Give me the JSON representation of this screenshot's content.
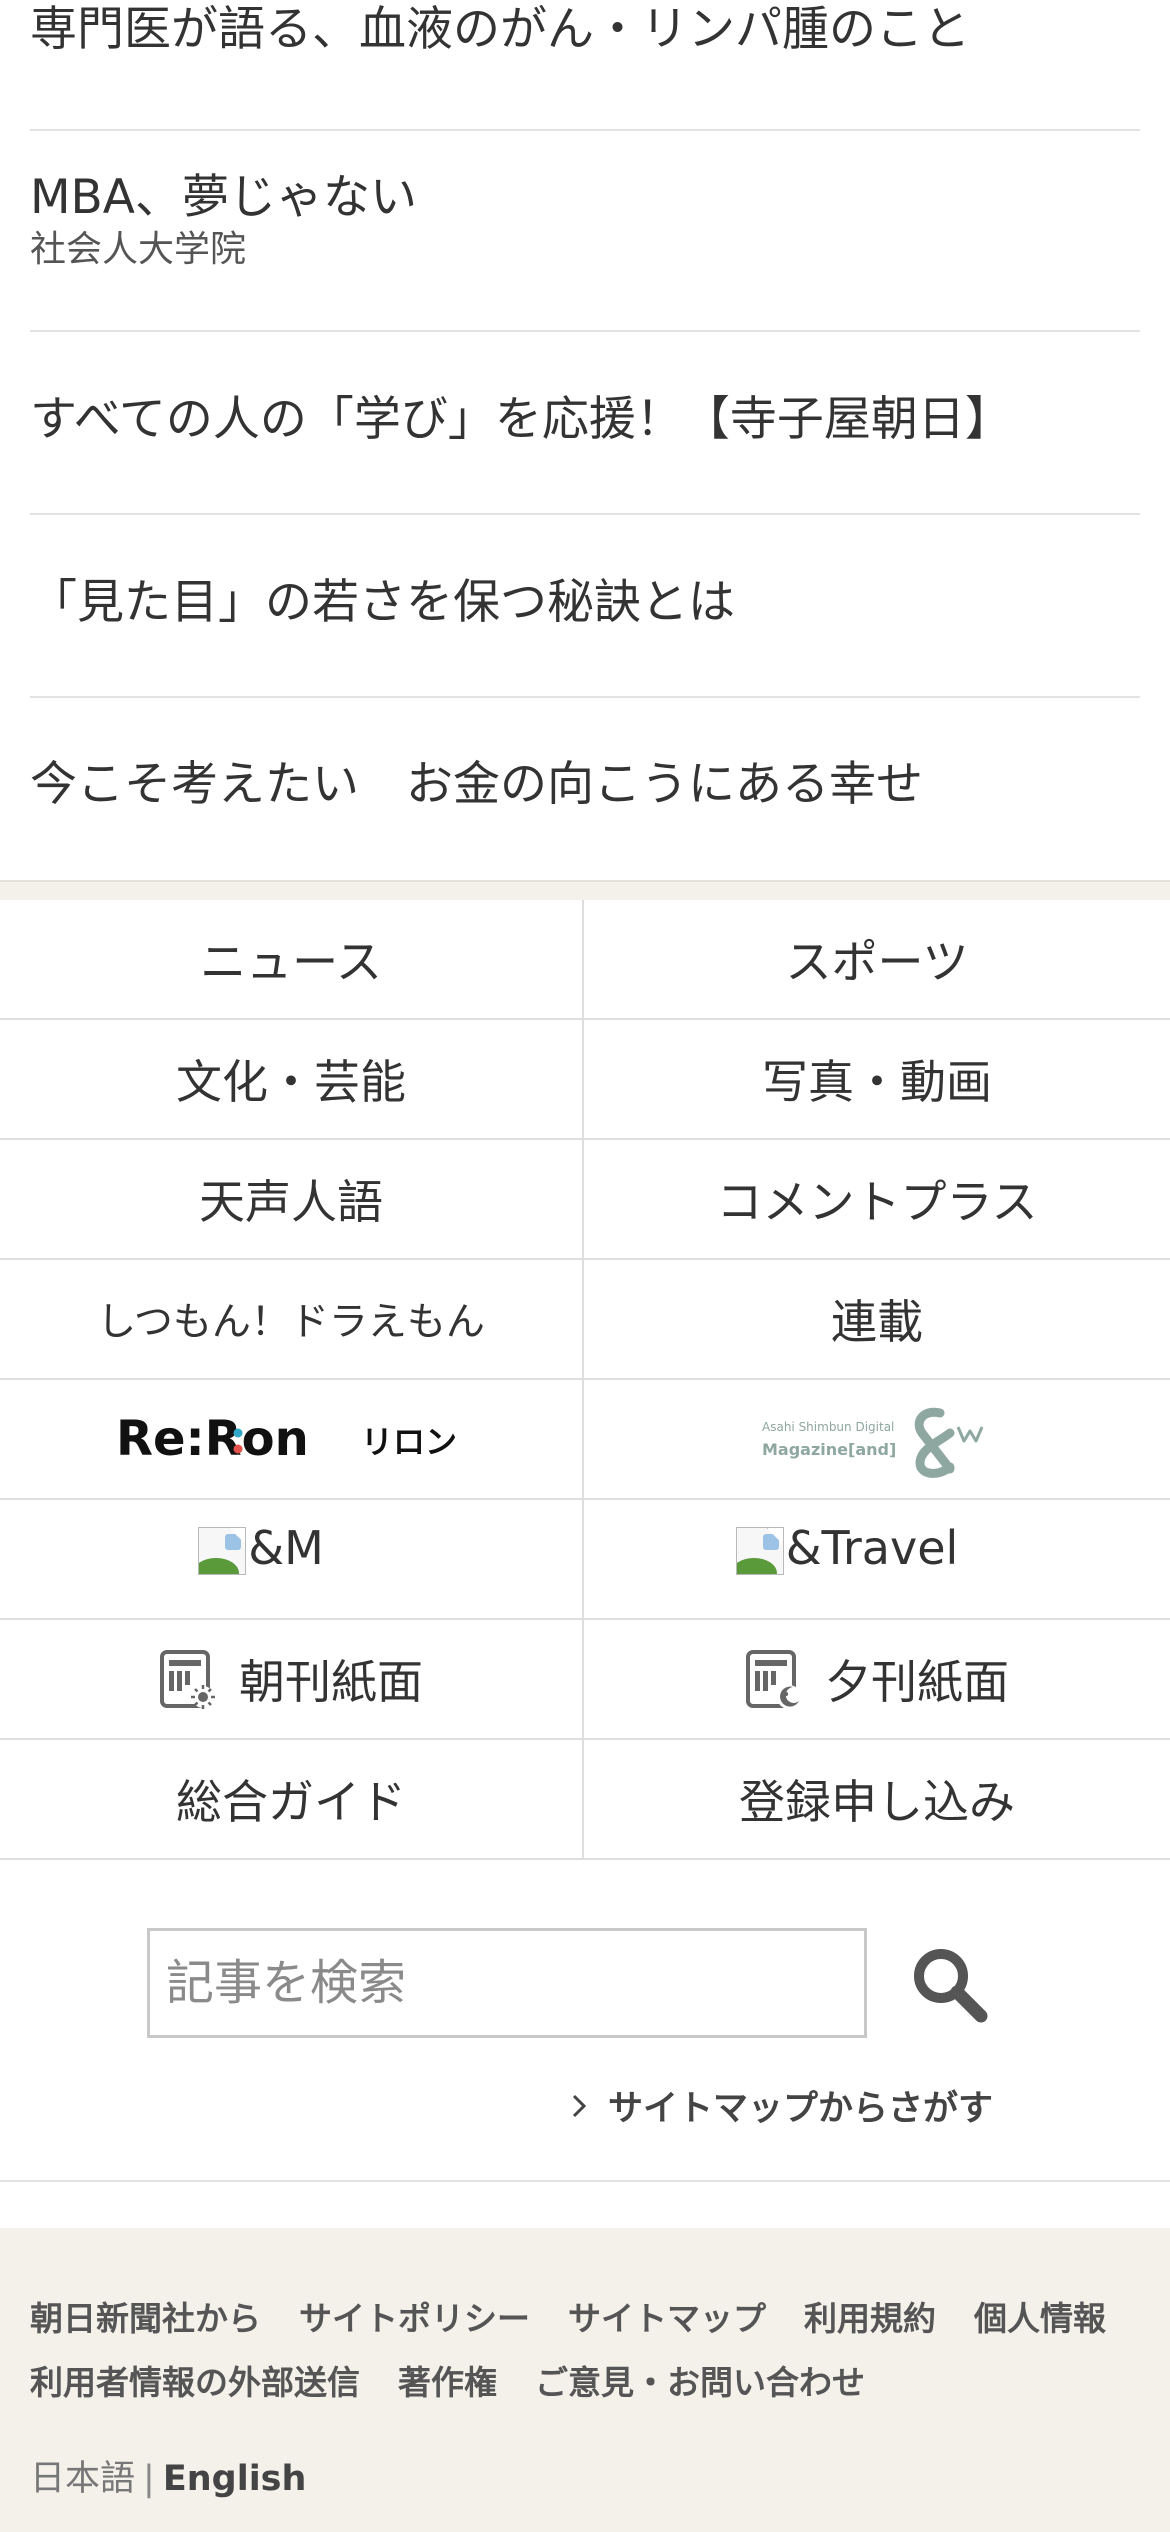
{
  "promos": [
    {
      "title": "専門医が語る、血液のがん・リンパ腫のこと",
      "subtitle": ""
    },
    {
      "title": "MBA、夢じゃない",
      "subtitle": "社会人大学院"
    },
    {
      "title": "すべての人の「学び」を応援！【寺子屋朝日】",
      "subtitle": ""
    },
    {
      "title": "「見た目」の若さを保つ秘訣とは",
      "subtitle": ""
    },
    {
      "title": "今こそ考えたい　お金の向こうにある幸せ",
      "subtitle": ""
    }
  ],
  "nav": {
    "news": "ニュース",
    "sports": "スポーツ",
    "culture": "文化・芸能",
    "photo_video": "写真・動画",
    "tensei_jingo": "天声人語",
    "comment_plus": "コメントプラス",
    "shitsumon": "しつもん！ドラえもん",
    "rensai": "連載",
    "reron_logo": "Re:Ron",
    "reron_kana": "リロン",
    "magazine_logo_line1": "Asahi Shimbun Digital",
    "magazine_logo_line2": "Magazine[and]",
    "and_m": "&M",
    "and_travel": "&Travel",
    "morning_paper": "朝刊紙面",
    "evening_paper": "夕刊紙面",
    "guide": "総合ガイド",
    "register": "登録申し込み"
  },
  "search": {
    "placeholder": "記事を検索",
    "sitemap_link": "サイトマップからさがす"
  },
  "footer": {
    "links_row1": [
      "朝日新聞社から",
      "サイトポリシー",
      "サイトマップ",
      "利用規約",
      "個人情報"
    ],
    "links_row2": [
      "利用者情報の外部送信",
      "著作権",
      "ご意見・お問い合わせ"
    ],
    "lang_ja": "日本語",
    "lang_sep": "|",
    "lang_en": "English"
  },
  "colors": {
    "text": "#333333",
    "footer_bg": "#f3f1ea",
    "divider": "#dedede",
    "magazine_accent": "#8fa7a1"
  }
}
